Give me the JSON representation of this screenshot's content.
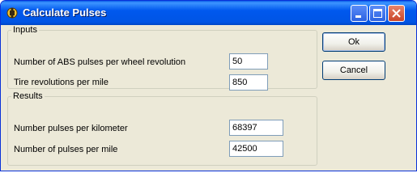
{
  "window": {
    "title": "Calculate Pulses"
  },
  "inputs": {
    "legend": "Inputs",
    "abs_pulses_label": "Number of ABS pulses per wheel revolution",
    "abs_pulses_value": "50",
    "tire_revs_label": "Tire revolutions per mile",
    "tire_revs_value": "850"
  },
  "results": {
    "legend": "Results",
    "pulses_km_label": "Number pulses per kilometer",
    "pulses_km_value": "68397",
    "pulses_mile_label": "Number of pulses per mile",
    "pulses_mile_value": "42500"
  },
  "buttons": {
    "ok": "Ok",
    "cancel": "Cancel"
  },
  "icons": {
    "title": "app-icon",
    "minimize": "minimize-icon",
    "maximize": "maximize-icon",
    "close": "close-icon"
  }
}
